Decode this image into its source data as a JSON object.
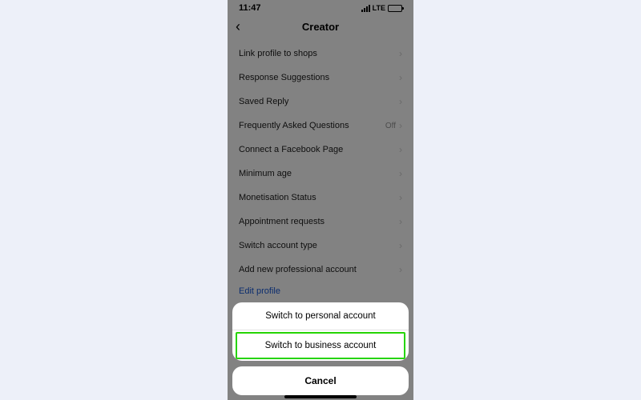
{
  "status": {
    "time": "11:47",
    "network": "LTE"
  },
  "header": {
    "title": "Creator"
  },
  "rows": [
    {
      "label": "Link profile to shops",
      "aux": ""
    },
    {
      "label": "Response Suggestions",
      "aux": ""
    },
    {
      "label": "Saved Reply",
      "aux": ""
    },
    {
      "label": "Frequently Asked Questions",
      "aux": "Off"
    },
    {
      "label": "Connect a Facebook Page",
      "aux": ""
    },
    {
      "label": "Minimum age",
      "aux": ""
    },
    {
      "label": "Monetisation Status",
      "aux": ""
    },
    {
      "label": "Appointment requests",
      "aux": ""
    },
    {
      "label": "Switch account type",
      "aux": ""
    },
    {
      "label": "Add new professional account",
      "aux": ""
    }
  ],
  "edit_link": "Edit profile",
  "sheet": {
    "option1": "Switch to personal account",
    "option2": "Switch to business account",
    "cancel": "Cancel"
  }
}
